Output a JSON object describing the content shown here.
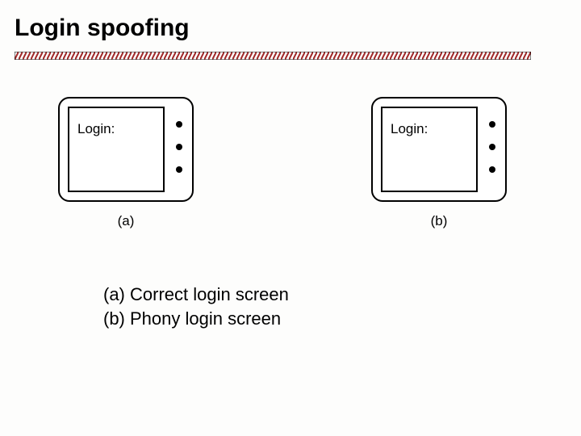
{
  "title": "Login spoofing",
  "monitors": {
    "a": {
      "label": "Login:",
      "caption": "(a)"
    },
    "b": {
      "label": "Login:",
      "caption": "(b)"
    }
  },
  "description": {
    "line1": "(a) Correct login screen",
    "line2": "(b) Phony login screen"
  }
}
